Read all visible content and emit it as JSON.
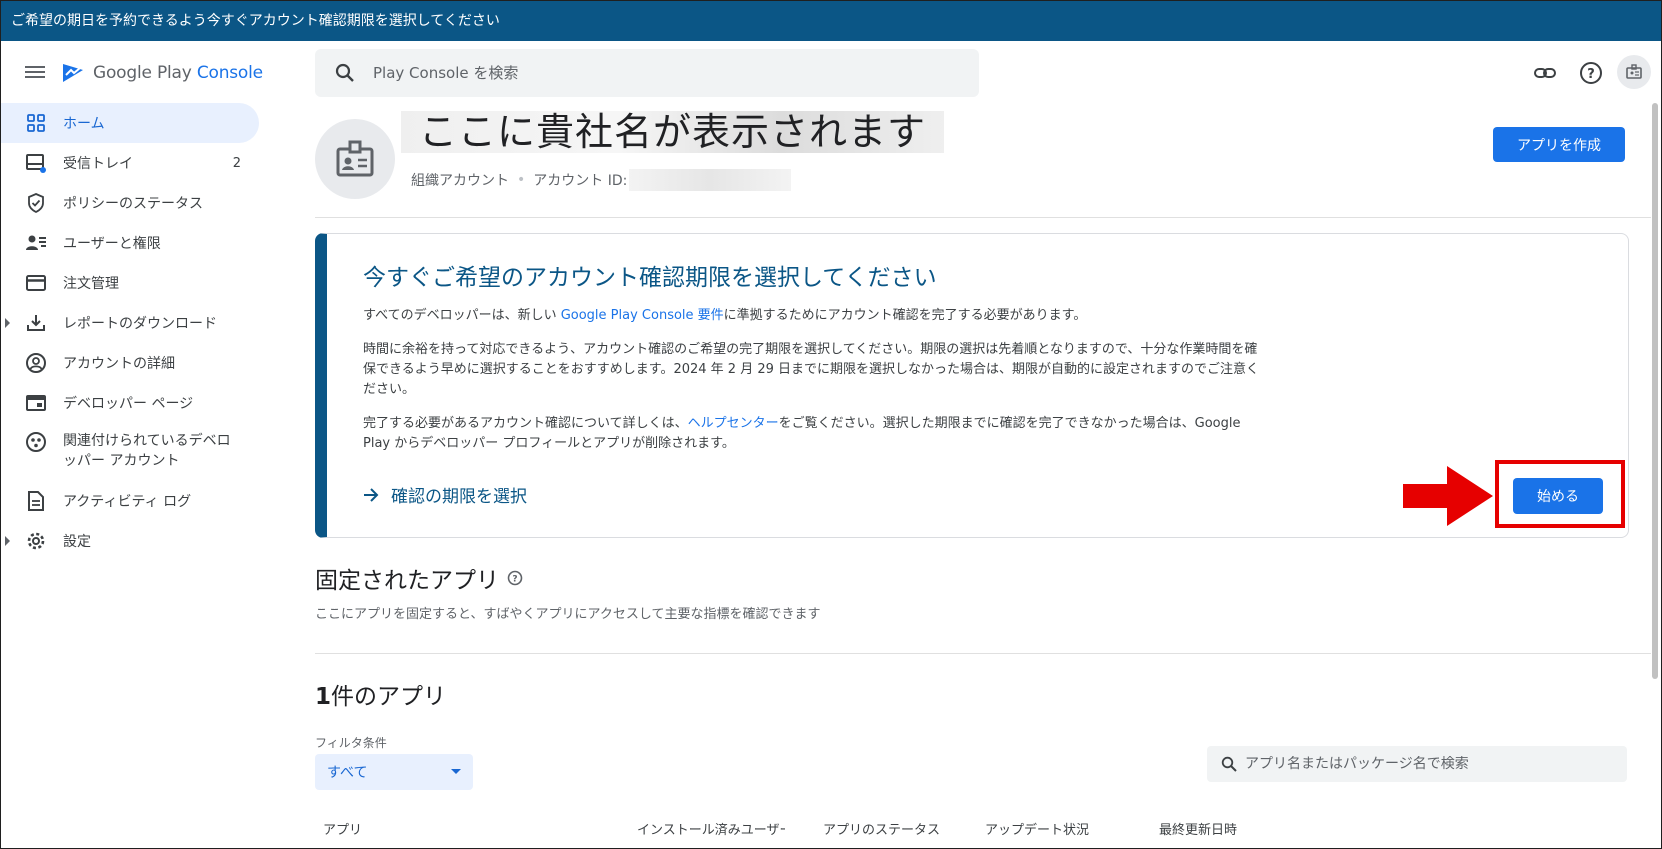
{
  "banner": {
    "text": "ご希望の期日を予約できるよう今すぐアカウント確認期限を選択してください"
  },
  "header": {
    "brand_google_play": "Google Play",
    "brand_console": "Console",
    "search_placeholder": "Play Console を検索",
    "icons": [
      "menu-icon",
      "search-icon",
      "link-icon",
      "help-icon",
      "account-icon"
    ]
  },
  "sidebar": {
    "items": [
      {
        "label": "ホーム",
        "icon": "dashboard-icon",
        "active": true
      },
      {
        "label": "受信トレイ",
        "icon": "inbox-icon",
        "count": "2"
      },
      {
        "label": "ポリシーのステータス",
        "icon": "shield-icon"
      },
      {
        "label": "ユーザーと権限",
        "icon": "users-icon"
      },
      {
        "label": "注文管理",
        "icon": "credit-card-icon"
      },
      {
        "label": "レポートのダウンロード",
        "icon": "download-icon",
        "expandable": true
      },
      {
        "label": "アカウントの詳細",
        "icon": "account-circle-icon"
      },
      {
        "label": "デベロッパー ページ",
        "icon": "web-page-icon"
      },
      {
        "label": "関連付けられているデベロッパー アカウント",
        "icon": "linked-accounts-icon"
      },
      {
        "label": "アクティビティ ログ",
        "icon": "document-icon"
      },
      {
        "label": "設定",
        "icon": "gear-icon",
        "expandable": true
      }
    ]
  },
  "account": {
    "company_name": "ここに貴社名が表示されます",
    "type": "組織アカウント",
    "id_label": "アカウント ID:",
    "create_app_label": "アプリを作成"
  },
  "notice": {
    "title": "今すぐご希望のアカウント確認期限を選択してください",
    "p1_before": "すべてのデベロッパーは、新しい ",
    "p1_link": "Google Play Console 要件",
    "p1_after": "に準拠するためにアカウント確認を完了する必要があります。",
    "p2": "時間に余裕を持って対応できるよう、アカウント確認のご希望の完了期限を選択してください。期限の選択は先着順となりますので、十分な作業時間を確保できるよう早めに選択することをおすすめします。2024 年 2 月 29 日までに期限を選択しなかった場合は、期限が自動的に設定されますのでご注意ください。",
    "p3_before": "完了する必要があるアカウント確認について詳しくは、",
    "p3_link": "ヘルプセンター",
    "p3_after": "をご覧ください。選択した期限までに確認を完了できなかった場合は、Google Play からデベロッパー プロフィールとアプリが削除されます。",
    "select_link_label": "確認の期限を選択",
    "start_button_label": "始める",
    "accent_color": "#0b5686",
    "highlight_color": "#e60000"
  },
  "pinned": {
    "title": "固定されたアプリ",
    "description": "ここにアプリを固定すると、すばやくアプリにアクセスして主要な指標を確認できます"
  },
  "apps": {
    "count_number": "1",
    "count_suffix": "件のアプリ",
    "filter_label": "フィルタ条件",
    "filter_value": "すべて",
    "search_placeholder": "アプリ名またはパッケージ名で検索",
    "columns": [
      "アプリ",
      "インストール済みユーザー",
      "アプリのステータス",
      "アップデート状況",
      "最終更新日時"
    ]
  }
}
